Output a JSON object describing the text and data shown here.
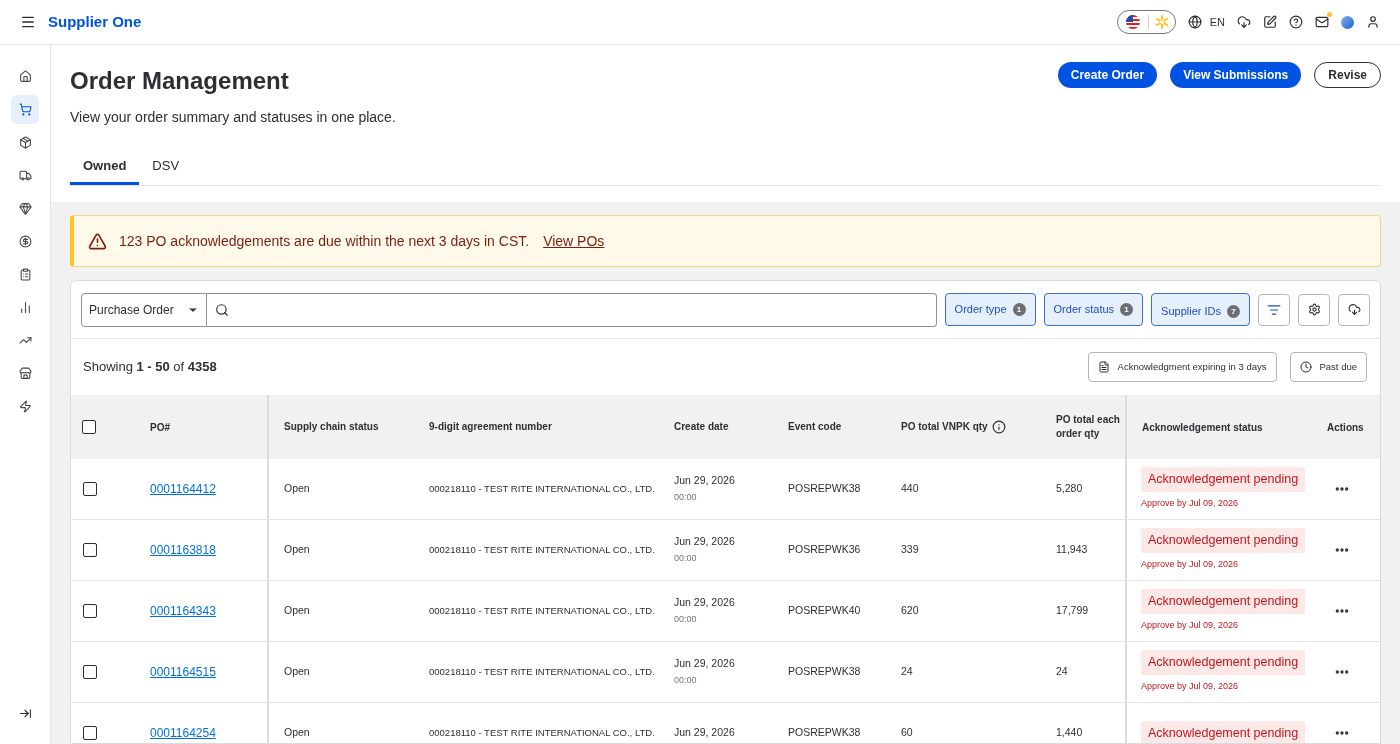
{
  "header": {
    "brand": "Supplier One",
    "language": "EN",
    "mail_unread": true
  },
  "sidebar": {
    "items": [
      {
        "selected": false
      },
      {
        "selected": true
      },
      {
        "selected": false
      },
      {
        "selected": false
      },
      {
        "selected": false
      },
      {
        "selected": false
      },
      {
        "selected": false
      },
      {
        "selected": false
      },
      {
        "selected": false
      },
      {
        "selected": false
      },
      {
        "selected": false
      }
    ]
  },
  "page": {
    "title": "Order Management",
    "subtitle": "View your order summary and statuses in one place.",
    "actions": [
      {
        "label": "Create Order",
        "kind": "primary"
      },
      {
        "label": "View Submissions",
        "kind": "primary"
      },
      {
        "label": "Revise",
        "kind": "secondary"
      }
    ]
  },
  "tabs": [
    {
      "label": "Owned",
      "selected": true
    },
    {
      "label": "DSV",
      "selected": false
    }
  ],
  "alert": {
    "text": "123 PO acknowledgements are due within the next 3 days in CST.",
    "link": "View POs"
  },
  "search": {
    "type": "Purchase Order"
  },
  "filters": [
    {
      "label": "Order type",
      "count": "1"
    },
    {
      "label": "Order status",
      "count": "1"
    },
    {
      "label": "Supplier IDs",
      "count": "7"
    }
  ],
  "results": {
    "text": "Showing **1 - 50** of **4358**"
  },
  "quick_filters": [
    {
      "label": "Acknowledgment expiring in 3 days",
      "kind": "document"
    },
    {
      "label": "Past due",
      "kind": "clock"
    }
  ],
  "table": {
    "all_checked": false,
    "columns": [
      "PO#",
      "Supply chain status",
      "9-digit agreement number",
      "Create date",
      "Event code",
      "PO total VNPK qty",
      "PO total each order qty",
      "Acknowledgement status",
      "Actions"
    ],
    "rows": [
      {
        "checked": false,
        "po": "0001164412",
        "status": "Open",
        "agreement": "000218110 - TEST RITE INTERNATIONAL CO., LTD.",
        "date": "Jun 29, 2026",
        "time": "00:00",
        "event": "POSREPWK38",
        "vnpk": "440",
        "each": "5,280",
        "ack": "Acknowledgement pending",
        "approve": "Approve by Jul 09, 2026"
      },
      {
        "checked": false,
        "po": "0001163818",
        "status": "Open",
        "agreement": "000218110 - TEST RITE INTERNATIONAL CO., LTD.",
        "date": "Jun 29, 2026",
        "time": "00:00",
        "event": "POSREPWK36",
        "vnpk": "339",
        "each": "11,943",
        "ack": "Acknowledgement pending",
        "approve": "Approve by Jul 09, 2026"
      },
      {
        "checked": false,
        "po": "0001164343",
        "status": "Open",
        "agreement": "000218110 - TEST RITE INTERNATIONAL CO., LTD.",
        "date": "Jun 29, 2026",
        "time": "00:00",
        "event": "POSREPWK40",
        "vnpk": "620",
        "each": "17,799",
        "ack": "Acknowledgement pending",
        "approve": "Approve by Jul 09, 2026"
      },
      {
        "checked": false,
        "po": "0001164515",
        "status": "Open",
        "agreement": "000218110 - TEST RITE INTERNATIONAL CO., LTD.",
        "date": "Jun 29, 2026",
        "time": "00:00",
        "event": "POSREPWK38",
        "vnpk": "24",
        "each": "24",
        "ack": "Acknowledgement pending",
        "approve": "Approve by Jul 09, 2026"
      },
      {
        "checked": false,
        "po": "0001164254",
        "status": "Open",
        "agreement": "000218110 - TEST RITE INTERNATIONAL CO., LTD.",
        "date": "Jun 29, 2026",
        "event": "POSREPWK38",
        "vnpk": "60",
        "each": "1,440",
        "ack": "Acknowledgement pending"
      }
    ]
  }
}
